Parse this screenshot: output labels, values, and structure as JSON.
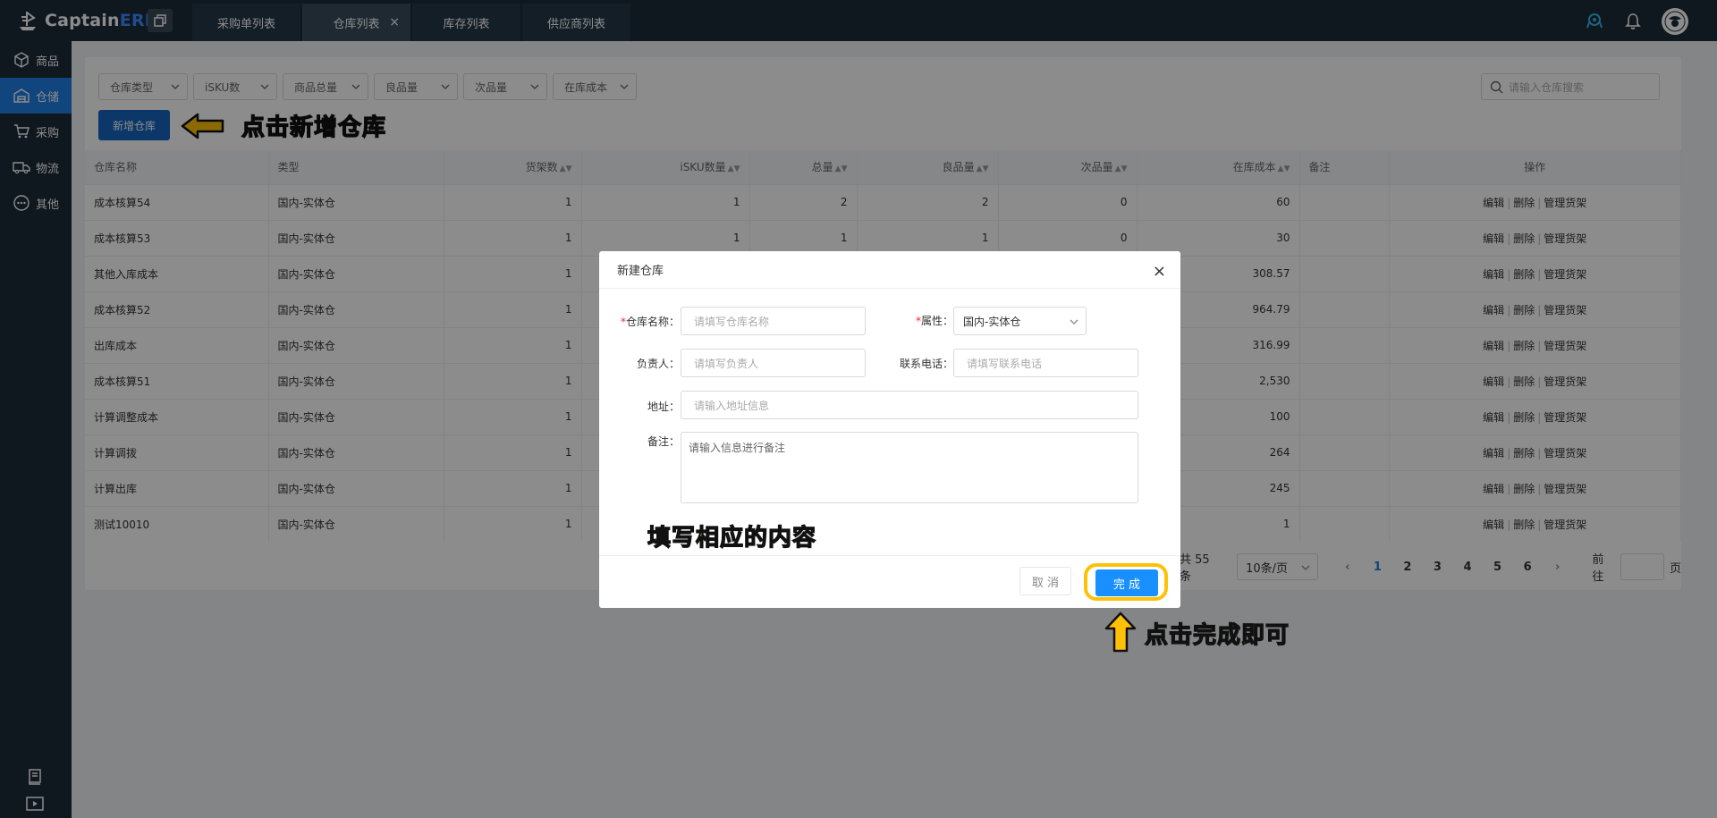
{
  "app": {
    "logo_main": "Captain",
    "logo_accent": "ERP"
  },
  "tabs": [
    {
      "label": "采购单列表"
    },
    {
      "label": "仓库列表",
      "close": "×"
    },
    {
      "label": "库存列表"
    },
    {
      "label": "供应商列表"
    }
  ],
  "sidebar": {
    "items": [
      {
        "label": "商品"
      },
      {
        "label": "仓储"
      },
      {
        "label": "采购"
      },
      {
        "label": "物流"
      },
      {
        "label": "其他"
      }
    ]
  },
  "filters": [
    "仓库类型",
    "iSKU数",
    "商品总量",
    "良品量",
    "次品量",
    "在库成本"
  ],
  "search": {
    "placeholder": "请输入仓库搜索"
  },
  "toolbar": {
    "add_label": "新增仓库"
  },
  "annotations": {
    "add_hint": "点击新增仓库",
    "fill_hint": "填写相应的内容",
    "done_hint": "点击完成即可"
  },
  "table": {
    "headers": [
      "仓库名称",
      "类型",
      "货架数",
      "iSKU数量",
      "总量",
      "良品量",
      "次品量",
      "在库成本",
      "备注",
      "操作"
    ],
    "rows": [
      {
        "name": "成本核算54",
        "type": "国内-实体仓",
        "shelves": "1",
        "isku": "1",
        "total": "2",
        "good": "2",
        "bad": "0",
        "cost": "60"
      },
      {
        "name": "成本核算53",
        "type": "国内-实体仓",
        "shelves": "1",
        "isku": "1",
        "total": "1",
        "good": "1",
        "bad": "0",
        "cost": "30"
      },
      {
        "name": "其他入库成本",
        "type": "国内-实体仓",
        "shelves": "1",
        "isku": "",
        "total": "",
        "good": "",
        "bad": "",
        "cost": "308.57"
      },
      {
        "name": "成本核算52",
        "type": "国内-实体仓",
        "shelves": "1",
        "isku": "",
        "total": "",
        "good": "",
        "bad": "",
        "cost": "964.79"
      },
      {
        "name": "出库成本",
        "type": "国内-实体仓",
        "shelves": "1",
        "isku": "",
        "total": "",
        "good": "",
        "bad": "",
        "cost": "316.99"
      },
      {
        "name": "成本核算51",
        "type": "国内-实体仓",
        "shelves": "1",
        "isku": "",
        "total": "",
        "good": "",
        "bad": "",
        "cost": "2,530"
      },
      {
        "name": "计算调整成本",
        "type": "国内-实体仓",
        "shelves": "1",
        "isku": "",
        "total": "",
        "good": "",
        "bad": "",
        "cost": "100"
      },
      {
        "name": "计算调拨",
        "type": "国内-实体仓",
        "shelves": "1",
        "isku": "",
        "total": "",
        "good": "",
        "bad": "",
        "cost": "264"
      },
      {
        "name": "计算出库",
        "type": "国内-实体仓",
        "shelves": "1",
        "isku": "",
        "total": "",
        "good": "",
        "bad": "",
        "cost": "245"
      },
      {
        "name": "测试10010",
        "type": "国内-实体仓",
        "shelves": "1",
        "isku": "",
        "total": "",
        "good": "",
        "bad": "",
        "cost": "1"
      }
    ],
    "ops": {
      "edit": "编辑",
      "delete": "删除",
      "shelf": "管理货架"
    }
  },
  "pager": {
    "total": "共 55 条",
    "size": "10条/页",
    "pages": [
      "1",
      "2",
      "3",
      "4",
      "5",
      "6"
    ],
    "goto_prefix": "前往",
    "goto_suffix": "页"
  },
  "modal": {
    "title": "新建仓库",
    "close": "×",
    "fields": {
      "name_label": "仓库名称：",
      "name_placeholder": "请填写仓库名称",
      "attr_label": "属性：",
      "attr_value": "国内-实体仓",
      "owner_label": "负责人：",
      "owner_placeholder": "请填写负责人",
      "phone_label": "联系电话：",
      "phone_placeholder": "请填写联系电话",
      "address_label": "地址：",
      "address_placeholder": "请输入地址信息",
      "remark_label": "备注：",
      "remark_placeholder": "请输入信息进行备注"
    },
    "required_mark": "*",
    "cancel": "取 消",
    "ok": "完 成"
  },
  "colors": {
    "accent": "#1e7fe3",
    "topbar": "#1c2b3a",
    "annotation": "#ffc107"
  }
}
